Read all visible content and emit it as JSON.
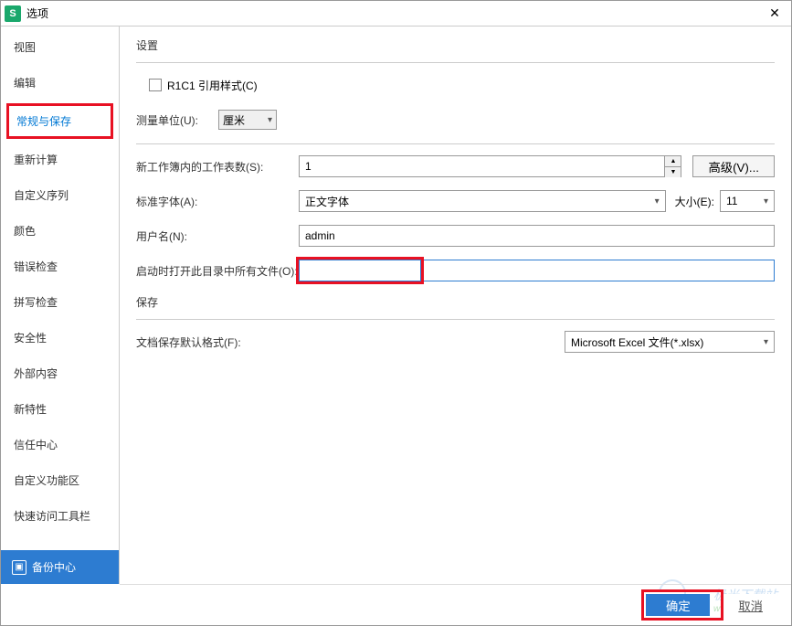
{
  "titlebar": {
    "app_icon_letter": "S",
    "title": "选项"
  },
  "sidebar": {
    "items": [
      {
        "label": "视图"
      },
      {
        "label": "编辑"
      },
      {
        "label": "常规与保存",
        "selected": true,
        "highlighted": true
      },
      {
        "label": "重新计算"
      },
      {
        "label": "自定义序列"
      },
      {
        "label": "颜色"
      },
      {
        "label": "错误检查"
      },
      {
        "label": "拼写检查"
      },
      {
        "label": "安全性"
      },
      {
        "label": "外部内容"
      },
      {
        "label": "新特性"
      },
      {
        "label": "信任中心"
      },
      {
        "label": "自定义功能区"
      },
      {
        "label": "快速访问工具栏"
      }
    ],
    "backup_label": "备份中心"
  },
  "settings": {
    "section_title": "设置",
    "r1c1": {
      "label": "R1C1 引用样式(C)",
      "checked": false
    },
    "unit": {
      "label": "测量单位(U):",
      "value": "厘米"
    },
    "sheets": {
      "label": "新工作簿内的工作表数(S):",
      "value": "1",
      "advanced_btn": "高级(V)..."
    },
    "font": {
      "label": "标准字体(A):",
      "value": "正文字体",
      "size_label": "大小(E):",
      "size_value": "11"
    },
    "username": {
      "label": "用户名(N):",
      "value": "admin"
    },
    "startup_path": {
      "label": "启动时打开此目录中所有文件(O):",
      "value": ""
    }
  },
  "save": {
    "section_title": "保存",
    "format": {
      "label": "文档保存默认格式(F):",
      "value": "Microsoft Excel 文件(*.xlsx)"
    }
  },
  "footer": {
    "ok": "确定",
    "cancel": "取消"
  },
  "watermark": {
    "text": "极光下载站",
    "url": "www.xz7.com"
  }
}
